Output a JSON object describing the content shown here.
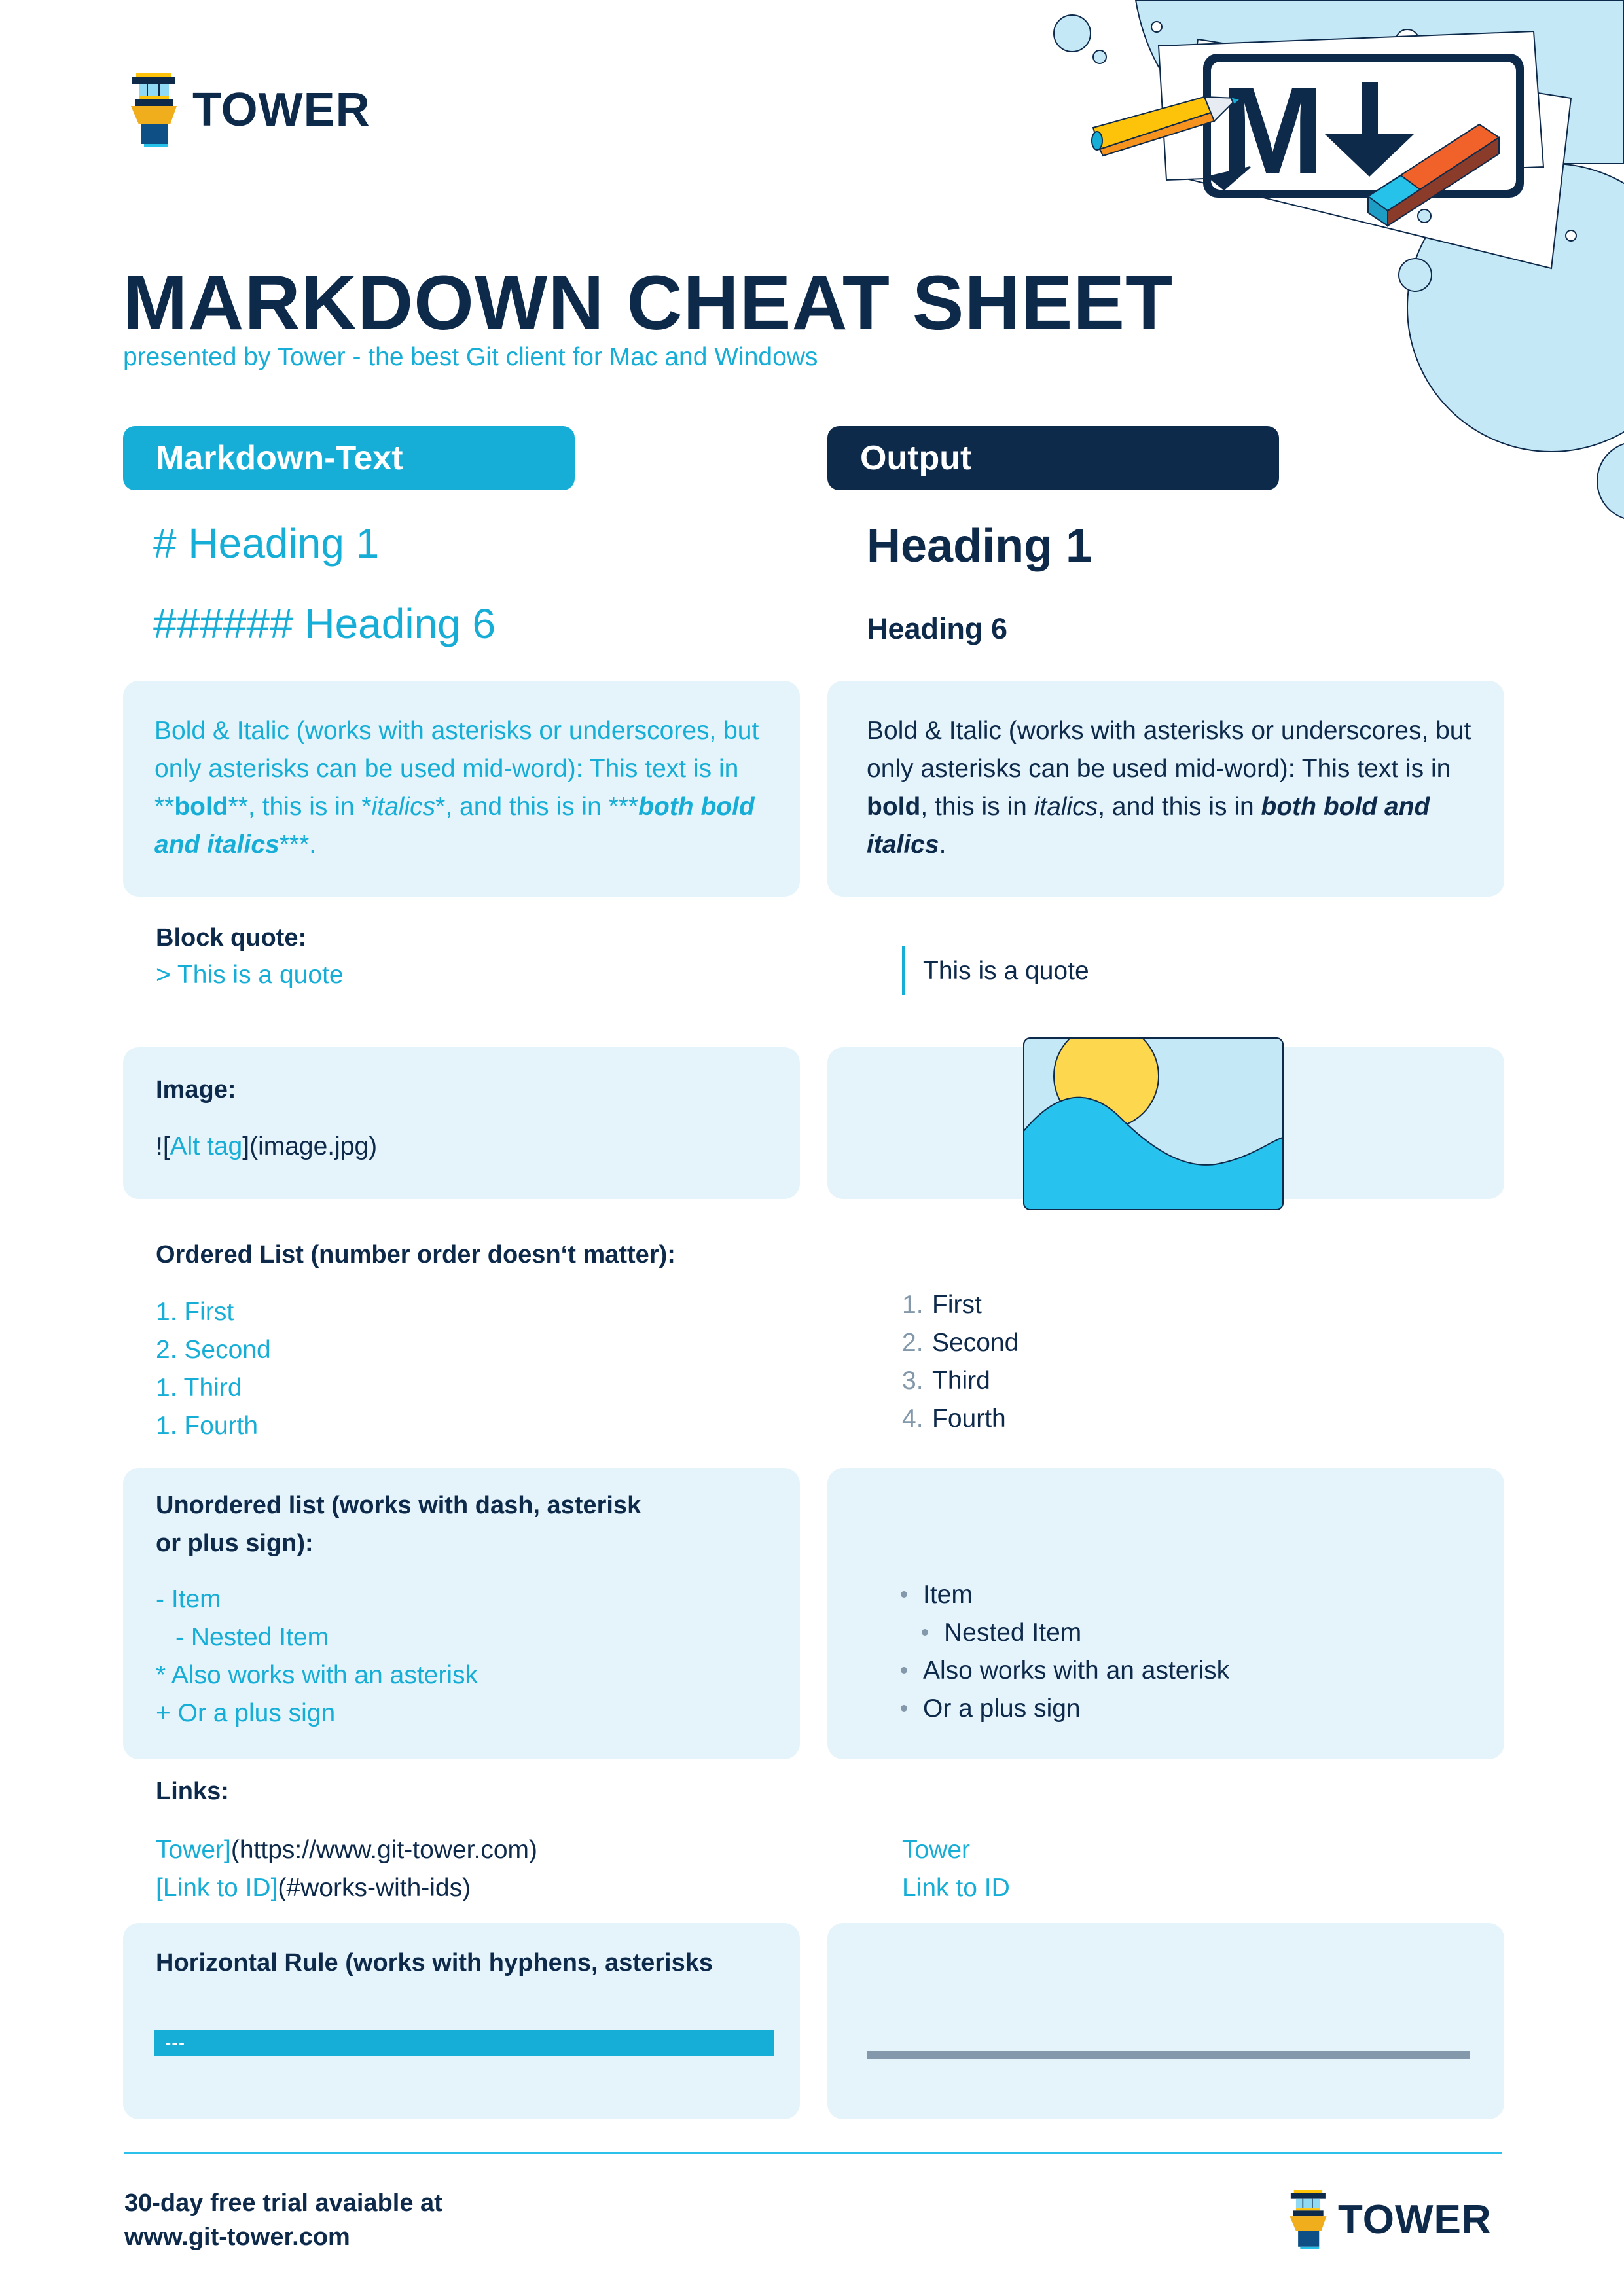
{
  "brand": {
    "logo_text": "TOWER",
    "colors": {
      "navy": "#0e2a4b",
      "cyan": "#16aed6",
      "light_panel": "#e5f4fb",
      "muted": "#8399ab",
      "bubble": "#c5e8f6"
    }
  },
  "header": {
    "title": "MARKDOWN CHEAT SHEET",
    "subtitle": "presented by Tower - the best Git client for Mac and Windows",
    "illustration": {
      "icon": "markdown-mark-icon",
      "label_m": "M",
      "label_arrow": "↓"
    }
  },
  "columns": {
    "left": "Markdown-Text",
    "right": "Output"
  },
  "headings": {
    "md_h1": "# Heading 1",
    "md_h6": "###### Heading 6",
    "out_h1": "Heading 1",
    "out_h6": "Heading 6"
  },
  "bold_italic": {
    "md": {
      "intro": "Bold & Italic (works with asterisks or underscores, but only asterisks can be used mid-word): This text is in ",
      "bold_open": "**",
      "bold": "bold",
      "bold_close": "**",
      "mid1": ", this is in ",
      "italic_open": "*",
      "italic": "italics",
      "italic_close": "*",
      "mid2": ", and this is in ",
      "both_open": "***",
      "both": "both bold and italics",
      "both_close": "***",
      "end": "."
    },
    "out": {
      "intro": "Bold & Italic (works with asterisks or underscores, but only asterisks can be used mid-word): This text is in ",
      "bold": "bold",
      "mid1": ", this is in ",
      "italic": "italics",
      "mid2": ", and this is in ",
      "both": "both bold and italics",
      "end": "."
    }
  },
  "blockquote": {
    "label": "Block quote:",
    "md": "> This is a quote",
    "out": "This is a quote"
  },
  "image": {
    "label": "Image:",
    "md_prefix": "![",
    "md_alt": "Alt tag",
    "md_bracket": "]",
    "md_src": "(image.jpg)",
    "out_icon": "landscape-image-icon"
  },
  "ordered_list": {
    "label": "Ordered List (number order doesn‘t matter):",
    "md": [
      "1. First",
      "2. Second",
      "1. Third",
      "1. Fourth"
    ],
    "out": [
      {
        "num": "1.",
        "text": "First"
      },
      {
        "num": "2.",
        "text": "Second"
      },
      {
        "num": "3.",
        "text": "Third"
      },
      {
        "num": "4.",
        "text": "Fourth"
      }
    ]
  },
  "unordered_list": {
    "label_line1": "Unordered list (works with dash, asterisk",
    "label_line2": "or plus sign):",
    "md": [
      "- Item",
      "- Nested Item",
      "* Also works with an asterisk",
      "+ Or a plus sign"
    ],
    "out": [
      {
        "text": "Item",
        "nested": false
      },
      {
        "text": "Nested Item",
        "nested": true
      },
      {
        "text": "Also works with an asterisk",
        "nested": false
      },
      {
        "text": "Or a plus sign",
        "nested": false
      }
    ]
  },
  "links": {
    "label": "Links:",
    "md": [
      {
        "text": "Tower]",
        "target": "(https://www.git-tower.com)"
      },
      {
        "text": "[Link to ID]",
        "target": "(#works-with-ids)"
      }
    ],
    "out": [
      "Tower",
      "Link to ID"
    ]
  },
  "horizontal_rule": {
    "label": "Horizontal Rule (works with hyphens, asterisks",
    "md": "---"
  },
  "footer": {
    "line1": "30-day free trial avaiable at",
    "line2": "www.git-tower.com",
    "logo_text": "TOWER"
  }
}
